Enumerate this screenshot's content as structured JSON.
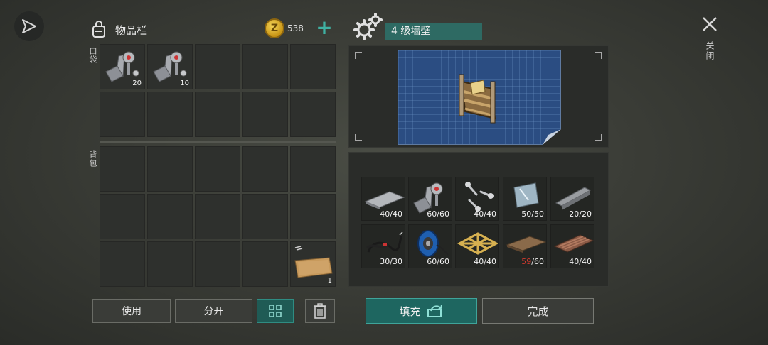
{
  "inventory": {
    "title": "物品栏",
    "coins": "538",
    "pocket_label": "口袋",
    "backpack_label": "背包",
    "pocket_slots": [
      {
        "item": "bolt-bracket-icon",
        "qty": "20"
      },
      {
        "item": "bolt-bracket-icon",
        "qty": "10"
      },
      {
        "item": "",
        "qty": ""
      },
      {
        "item": "",
        "qty": ""
      },
      {
        "item": "",
        "qty": ""
      },
      {
        "item": "",
        "qty": ""
      },
      {
        "item": "",
        "qty": ""
      },
      {
        "item": "",
        "qty": ""
      },
      {
        "item": "",
        "qty": ""
      },
      {
        "item": "",
        "qty": ""
      }
    ],
    "backpack_last_item_qty": "1"
  },
  "buttons": {
    "use": "使用",
    "split": "分开",
    "fill": "填充",
    "done": "完成",
    "close": "关闭"
  },
  "recipe": {
    "name": "4 级墙壁",
    "materials": [
      {
        "icon": "metal-sheet-icon",
        "have": "40",
        "need": "40",
        "short": false
      },
      {
        "icon": "bolt-bracket-icon",
        "have": "60",
        "need": "60",
        "short": false
      },
      {
        "icon": "screws-icon",
        "have": "40",
        "need": "40",
        "short": false
      },
      {
        "icon": "glass-pane-icon",
        "have": "50",
        "need": "50",
        "short": false
      },
      {
        "icon": "metal-profile-icon",
        "have": "20",
        "need": "20",
        "short": false
      },
      {
        "icon": "wire-icon",
        "have": "30",
        "need": "30",
        "short": false
      },
      {
        "icon": "cable-spool-icon",
        "have": "60",
        "need": "60",
        "short": false
      },
      {
        "icon": "wood-frame-icon",
        "have": "40",
        "need": "40",
        "short": false
      },
      {
        "icon": "plank-board-icon",
        "have": "59",
        "need": "60",
        "short": true
      },
      {
        "icon": "corrugated-sheet-icon",
        "have": "40",
        "need": "40",
        "short": false
      }
    ]
  },
  "colors": {
    "accent": "#2e6a63",
    "shortage": "#d23a2e",
    "coin": "#e0b530"
  }
}
